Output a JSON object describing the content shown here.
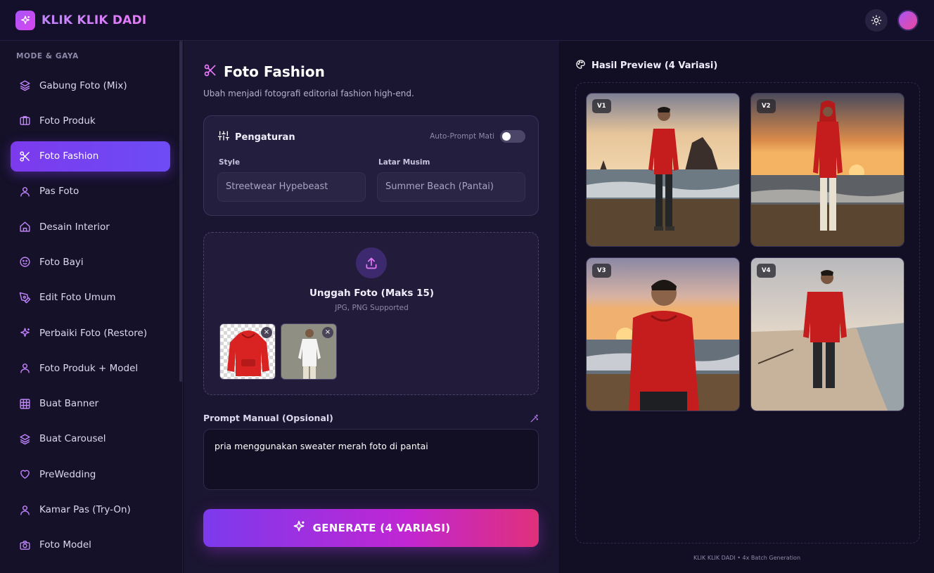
{
  "app": {
    "title": "KLIK KLIK DADI"
  },
  "sidebar": {
    "section_label": "MODE & GAYA",
    "items": [
      {
        "label": "Gabung Foto (Mix)",
        "icon": "layers-icon"
      },
      {
        "label": "Foto Produk",
        "icon": "box-icon"
      },
      {
        "label": "Foto Fashion",
        "icon": "scissors-icon",
        "active": true
      },
      {
        "label": "Pas Foto",
        "icon": "user-icon"
      },
      {
        "label": "Desain Interior",
        "icon": "home-icon"
      },
      {
        "label": "Foto Bayi",
        "icon": "baby-icon"
      },
      {
        "label": "Edit Foto Umum",
        "icon": "pen-icon"
      },
      {
        "label": "Perbaiki Foto (Restore)",
        "icon": "sparkles-icon"
      },
      {
        "label": "Foto Produk + Model",
        "icon": "user-icon"
      },
      {
        "label": "Buat Banner",
        "icon": "grid-icon"
      },
      {
        "label": "Buat Carousel",
        "icon": "layers-icon"
      },
      {
        "label": "PreWedding",
        "icon": "heart-icon"
      },
      {
        "label": "Kamar Pas (Try-On)",
        "icon": "user-icon"
      },
      {
        "label": "Foto Model",
        "icon": "camera-icon"
      }
    ]
  },
  "main": {
    "title": "Foto Fashion",
    "subtitle": "Ubah menjadi fotografi editorial fashion high-end.",
    "settings": {
      "title": "Pengaturan",
      "auto_prompt_label": "Auto-Prompt Mati",
      "auto_prompt_on": false,
      "style_label": "Style",
      "style_value": "Streetwear Hypebeast",
      "season_label": "Latar Musim",
      "season_value": "Summer Beach (Pantai)"
    },
    "upload": {
      "title": "Unggah Foto (Maks 15)",
      "subtitle": "JPG, PNG Supported",
      "files": [
        {
          "name": "red-hoodie",
          "close": "×"
        },
        {
          "name": "white-shirt-model",
          "close": "×"
        }
      ]
    },
    "prompt": {
      "label": "Prompt Manual (Opsional)",
      "value": "pria menggunakan sweater merah foto di pantai"
    },
    "generate_label": "GENERATE (4 VARIASI)"
  },
  "preview": {
    "title": "Hasil Preview (4 Variasi)",
    "variants": [
      {
        "badge": "V1"
      },
      {
        "badge": "V2"
      },
      {
        "badge": "V3"
      },
      {
        "badge": "V4"
      }
    ],
    "footer": "KLIK KLIK DADI • 4x Batch Generation"
  },
  "colors": {
    "accent": "#7c3aed",
    "accent_pink": "#e0307a",
    "background": "#0f0c22",
    "panel": "#1a1530"
  }
}
